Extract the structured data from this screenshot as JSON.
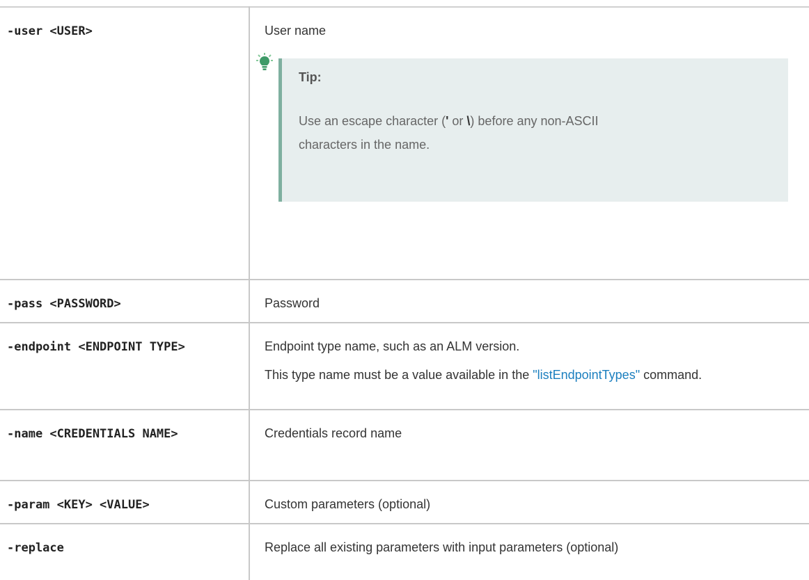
{
  "rows": [
    {
      "param": "-user <USER>",
      "desc": "User name",
      "tip": {
        "title": "Tip:",
        "text_before": "Use an escape character (",
        "char1": "'",
        "text_or": " or ",
        "char2": "\\",
        "text_after": ") before any non-ASCII characters in the name."
      }
    },
    {
      "param": "-pass <PASSWORD>",
      "desc": "Password"
    },
    {
      "param": "-endpoint <ENDPOINT TYPE>",
      "desc": "Endpoint type name, such as an ALM version.",
      "desc2_before": "This type name must be a value available in the ",
      "desc2_link": "\"listEndpointTypes\"",
      "desc2_after": " command."
    },
    {
      "param": "-name <CREDENTIALS NAME>",
      "desc": "Credentials record name"
    },
    {
      "param": "-param <KEY> <VALUE>",
      "desc": "Custom parameters (optional)"
    },
    {
      "param": "-replace",
      "desc": "Replace all existing parameters with input parameters (optional)"
    }
  ],
  "colors": {
    "link": "#1b7fbf",
    "tip_background": "#e7eeee",
    "tip_border": "#7fb0a0",
    "grid": "#c8c8c8"
  },
  "icons": {
    "tip": "lightbulb-icon"
  }
}
